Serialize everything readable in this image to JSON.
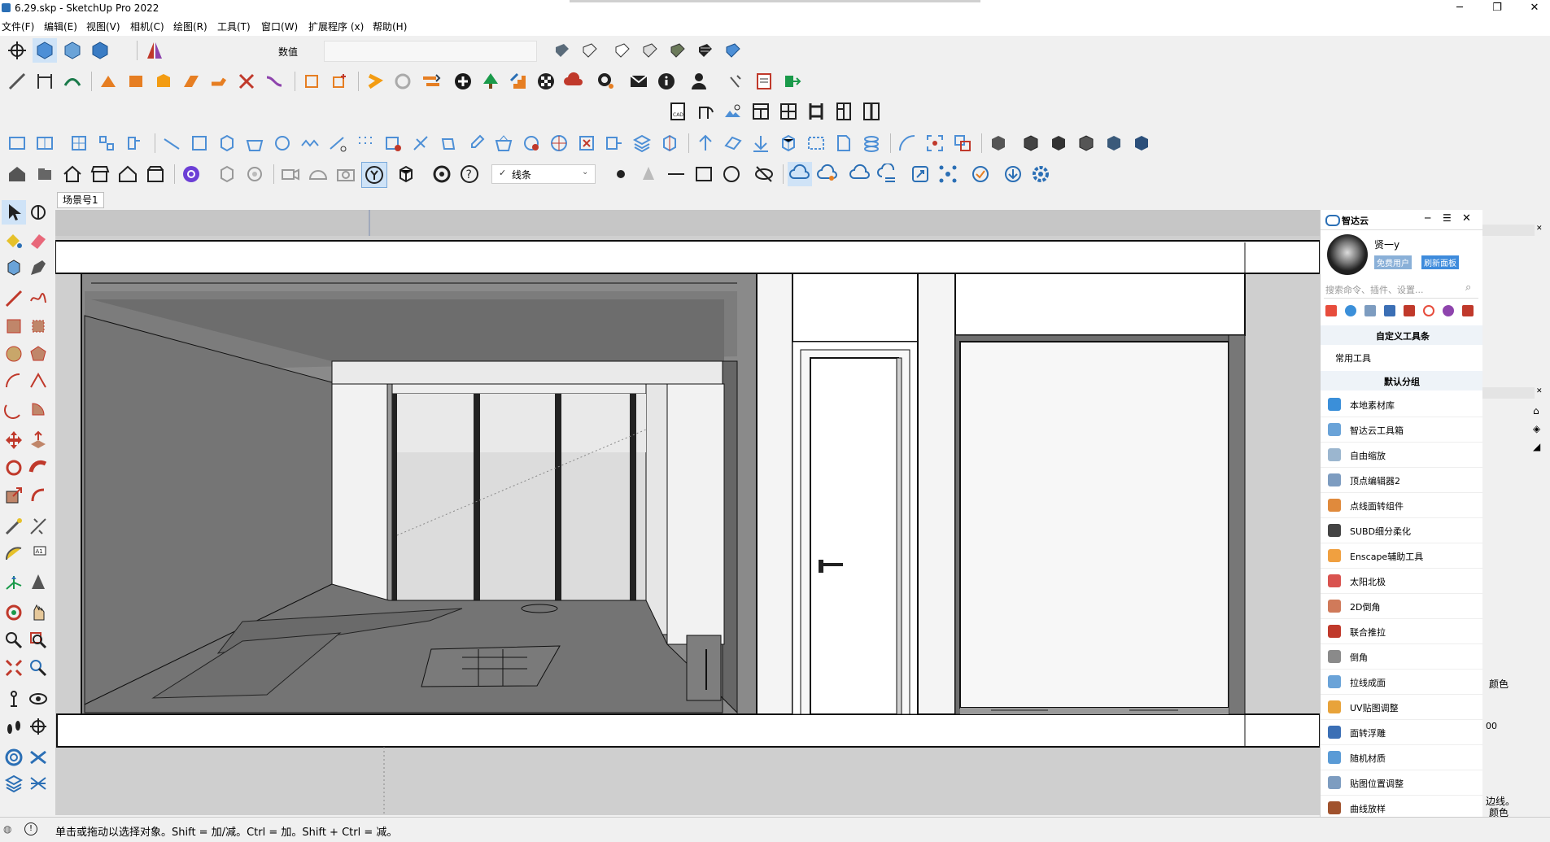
{
  "window": {
    "title": "6.29.skp - SketchUp Pro 2022"
  },
  "menu": [
    "文件(F)",
    "编辑(E)",
    "视图(V)",
    "相机(C)",
    "绘图(R)",
    "工具(T)",
    "窗口(W)",
    "扩展程序 (x)",
    "帮助(H)"
  ],
  "measurements": {
    "label": "数值"
  },
  "style_dropdown": {
    "value": "线条"
  },
  "scene": {
    "tab": "场景号1"
  },
  "status": {
    "text": "单击或拖动以选择对象。Shift = 加/减。Ctrl = 加。Shift + Ctrl = 减。"
  },
  "panel": {
    "title": "智达云",
    "user": "贤一y",
    "badge_free": "免费用户",
    "badge_refresh": "刷新面板",
    "search_placeholder": "搜索命令、插件、设置...",
    "custom_toolbar": "自定义工具条",
    "common_tools": "常用工具",
    "default_group": "默认分组",
    "items": [
      "本地素材库",
      "智达云工具箱",
      "自由缩放",
      "顶点编辑器2",
      "点线面转组件",
      "SUBD细分柔化",
      "Enscape辅助工具",
      "太阳北极",
      "2D倒角",
      "联合推拉",
      "倒角",
      "拉线成面",
      "UV贴图调整",
      "面转浮雕",
      "随机材质",
      "贴图位置调整",
      "曲线放样"
    ],
    "item_colors": [
      "#3b8fd9",
      "#6aa3d8",
      "#9bb6cf",
      "#7d9cc0",
      "#e08a3c",
      "#444444",
      "#f0a040",
      "#d9534f",
      "#d07a5a",
      "#c0392b",
      "#8a8a8a",
      "#6aa3d8",
      "#e8a33a",
      "#3b6fb5",
      "#5a9bd6",
      "#7d9cc0",
      "#a0522d"
    ]
  },
  "right_strip": {
    "text1": "颜色",
    "text2": "00",
    "text3": "边线。",
    "text4": "颜色"
  }
}
